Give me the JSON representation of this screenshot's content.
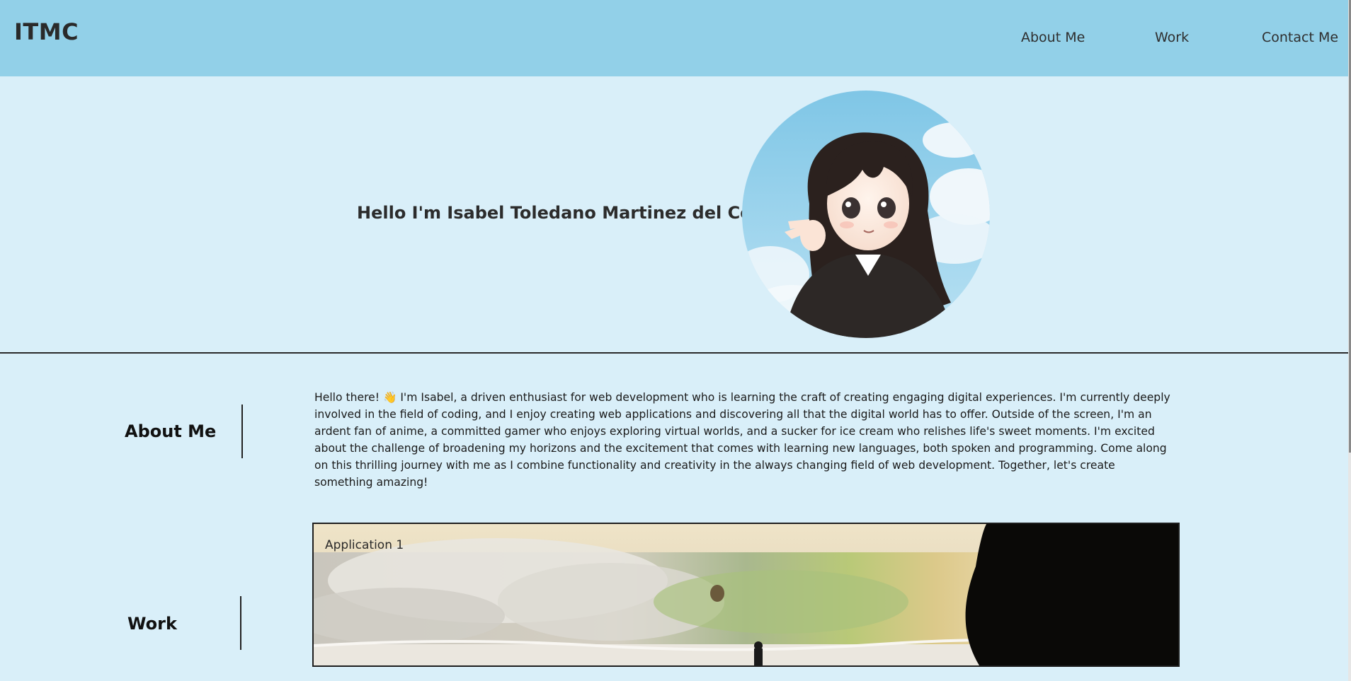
{
  "header": {
    "logo": "ITMC",
    "nav": [
      {
        "label": "About Me"
      },
      {
        "label": "Work"
      },
      {
        "label": "Contact Me"
      }
    ],
    "background": "#92d0e8"
  },
  "hero": {
    "title": "Hello I'm Isabel Toledano Martinez del Cerro"
  },
  "about": {
    "heading": "About Me",
    "text": "Hello there! 👋 I'm Isabel, a driven enthusiast for web development who is learning the craft of creating engaging digital experiences. I'm currently deeply involved in the field of coding, and I enjoy creating web applications and discovering all that the digital world has to offer. Outside of the screen, I'm an ardent fan of anime, a committed gamer who enjoys exploring virtual worlds, and a sucker for ice cream who relishes life's sweet moments. I'm excited about the challenge of broadening my horizons and the excitement that comes with learning new languages, both spoken and programming. Come along on this thrilling journey with me as I combine functionality and creativity in the always changing field of web development. Together, let's create something amazing!"
  },
  "work": {
    "heading": "Work",
    "projects": [
      {
        "title": "Application 1"
      }
    ]
  },
  "colors": {
    "page_background": "#d9eff9",
    "header_background": "#92d0e8"
  }
}
